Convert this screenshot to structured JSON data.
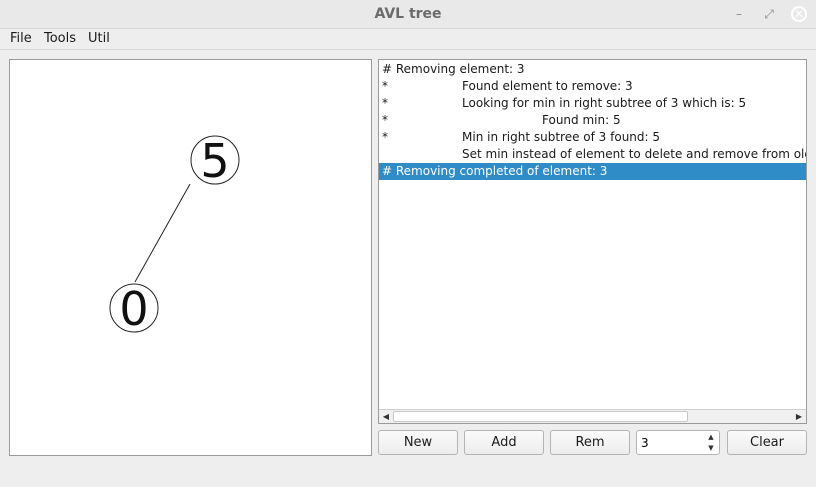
{
  "window": {
    "title": "AVL tree",
    "minimize_glyph": "–",
    "restore_glyph": "⤢",
    "close_glyph": "✕"
  },
  "menu": [
    "File",
    "Tools",
    "Util"
  ],
  "tree": {
    "nodes": [
      {
        "label": "5",
        "role": "root"
      },
      {
        "label": "0",
        "role": "left-child"
      }
    ]
  },
  "log": {
    "rows": [
      {
        "marker": "# Removing element: 3",
        "text": "",
        "indent": 0,
        "selected": false
      },
      {
        "marker": "*",
        "text": "Found element to remove: 3",
        "indent": 1,
        "selected": false
      },
      {
        "marker": "*",
        "text": "Looking for min in right subtree of 3 which is: 5",
        "indent": 1,
        "selected": false
      },
      {
        "marker": "*",
        "text": "Found min: 5",
        "indent": 2,
        "selected": false
      },
      {
        "marker": "*",
        "text": "Min in right subtree of 3 found: 5",
        "indent": 1,
        "selected": false
      },
      {
        "marker": "",
        "text": "Set min instead of element to delete and remove from old pla",
        "indent": 1,
        "selected": false
      },
      {
        "marker": "# Removing completed of element: 3",
        "text": "",
        "indent": 0,
        "selected": true
      }
    ],
    "scroll_position": 0.74
  },
  "controls": {
    "new_label": "New",
    "add_label": "Add",
    "rem_label": "Rem",
    "value": "3",
    "clear_label": "Clear"
  },
  "colors": {
    "selection": "#308cc6",
    "canvas_bg": "#ffffff"
  }
}
